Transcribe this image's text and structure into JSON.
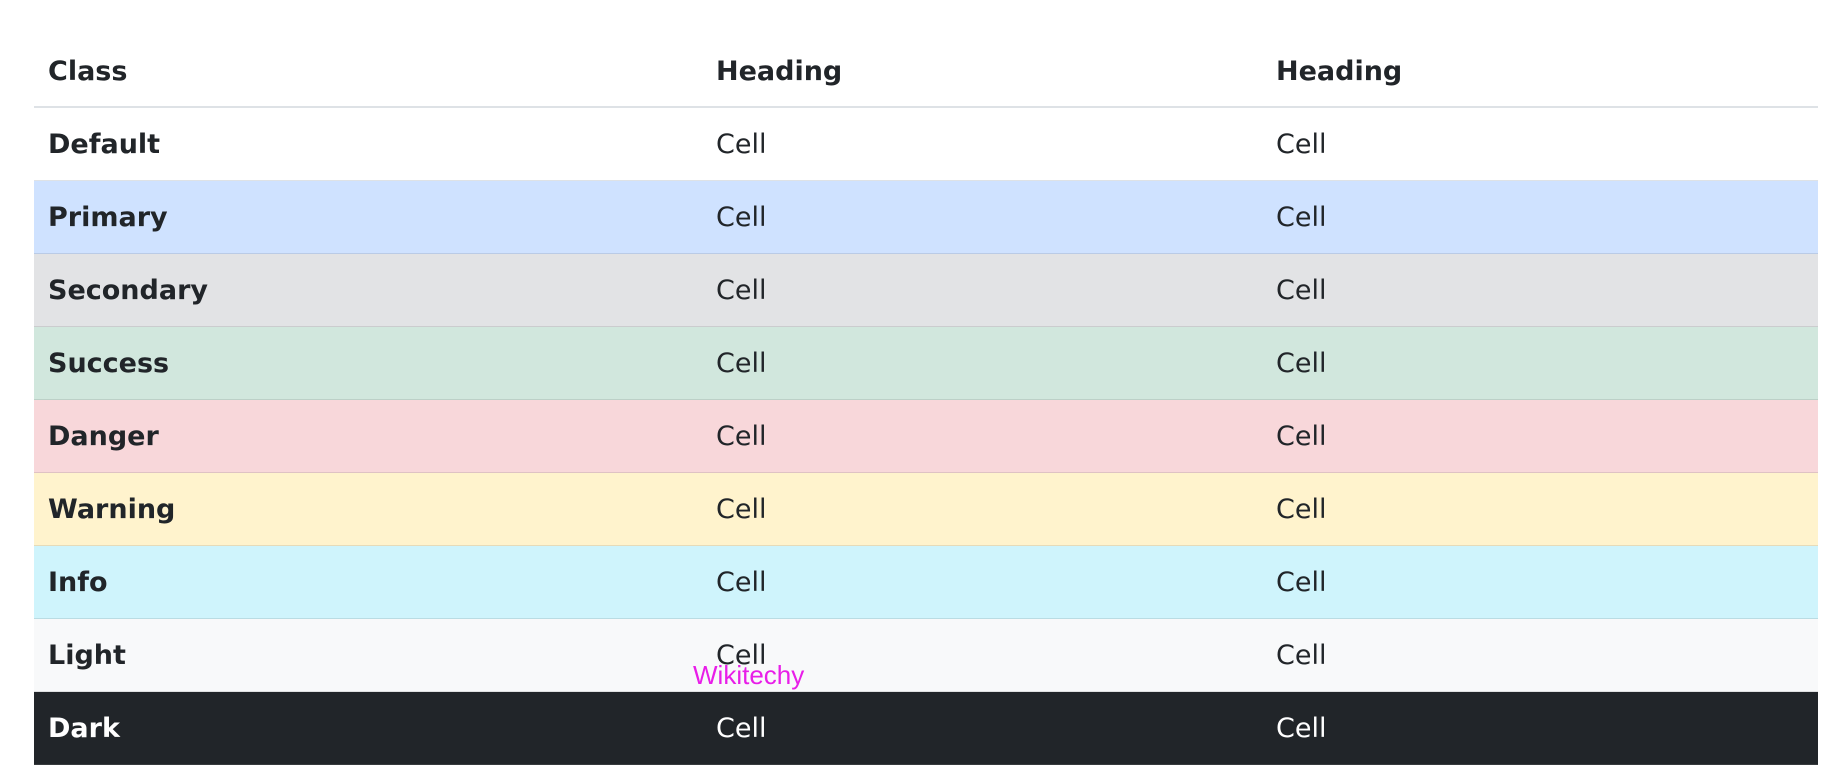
{
  "table": {
    "headers": [
      "Class",
      "Heading",
      "Heading"
    ],
    "rows": [
      {
        "label": "Default",
        "cells": [
          "Cell",
          "Cell"
        ],
        "variant": "default",
        "color": "#ffffff"
      },
      {
        "label": "Primary",
        "cells": [
          "Cell",
          "Cell"
        ],
        "variant": "primary",
        "color": "#cfe2ff"
      },
      {
        "label": "Secondary",
        "cells": [
          "Cell",
          "Cell"
        ],
        "variant": "secondary",
        "color": "#e2e3e5"
      },
      {
        "label": "Success",
        "cells": [
          "Cell",
          "Cell"
        ],
        "variant": "success",
        "color": "#d1e7dd"
      },
      {
        "label": "Danger",
        "cells": [
          "Cell",
          "Cell"
        ],
        "variant": "danger",
        "color": "#f8d7da"
      },
      {
        "label": "Warning",
        "cells": [
          "Cell",
          "Cell"
        ],
        "variant": "warning",
        "color": "#fff3cd"
      },
      {
        "label": "Info",
        "cells": [
          "Cell",
          "Cell"
        ],
        "variant": "info",
        "color": "#cff4fc"
      },
      {
        "label": "Light",
        "cells": [
          "Cell",
          "Cell"
        ],
        "variant": "light",
        "color": "#f8f9fa"
      },
      {
        "label": "Dark",
        "cells": [
          "Cell",
          "Cell"
        ],
        "variant": "dark",
        "color": "#212529"
      }
    ]
  },
  "watermark": {
    "text": "Wikitechy",
    "color": "#e81ee8"
  }
}
